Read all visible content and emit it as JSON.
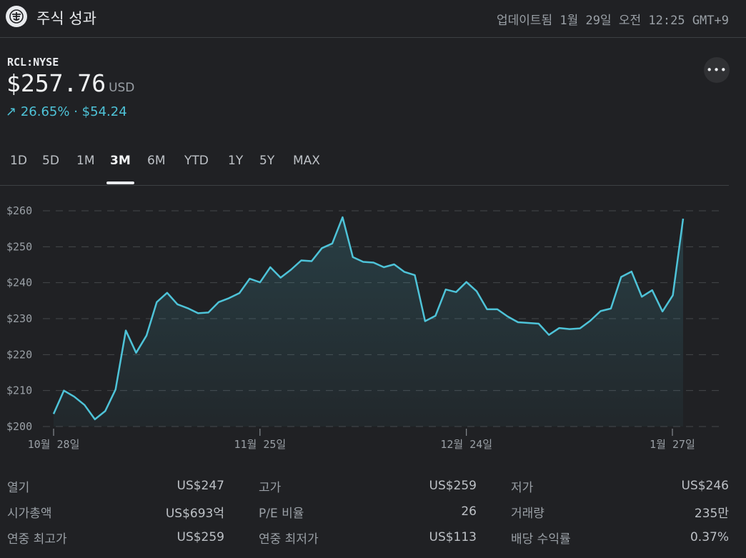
{
  "header": {
    "title": "주식 성과",
    "updated": "업데이트됨 1월 29일 오전 12:25 GMT+9",
    "logo_icon": "ship-wheel-icon"
  },
  "quote": {
    "ticker": "RCL:NYSE",
    "price": "$257.76",
    "currency": "USD",
    "change_arrow": "↗",
    "change_percent": "26.65%",
    "separator": "·",
    "change_amount": "$54.24",
    "more_label": "•••",
    "accent_color": "#4ec3d8"
  },
  "tabs": [
    {
      "label": "1D",
      "active": false
    },
    {
      "label": "5D",
      "active": false
    },
    {
      "label": "1M",
      "active": false
    },
    {
      "label": "3M",
      "active": true
    },
    {
      "label": "6M",
      "active": false
    },
    {
      "label": "YTD",
      "active": false
    },
    {
      "label": "1Y",
      "active": false
    },
    {
      "label": "5Y",
      "active": false
    },
    {
      "label": "MAX",
      "active": false
    }
  ],
  "chart_data": {
    "type": "area",
    "ylim": [
      200,
      260
    ],
    "yticks": [
      260,
      250,
      240,
      230,
      220,
      210,
      200
    ],
    "ytick_labels": [
      "$260",
      "$250",
      "$240",
      "$230",
      "$220",
      "$210",
      "$200"
    ],
    "xtick_labels": [
      "10월 28일",
      "11월 25일",
      "12월 24일",
      "1월 27일"
    ],
    "xtick_index": [
      0,
      20,
      40,
      60
    ],
    "grid": true,
    "line_color": "#4ec3d8",
    "series": [
      {
        "values": [
          203.5,
          210,
          208.3,
          206,
          202,
          204.3,
          210.3,
          226.7,
          220.5,
          225.3,
          234.6,
          237.2,
          234,
          232.9,
          231.5,
          231.7,
          234.6,
          235.7,
          237.1,
          241.1,
          240.1,
          244.3,
          241.4,
          243.6,
          246.2,
          246,
          249.6,
          250.9,
          258.2,
          247.1,
          245.8,
          245.6,
          244.3,
          245.1,
          243,
          242.1,
          229.3,
          230.8,
          238.1,
          237.4,
          240.2,
          237.6,
          232.6,
          232.6,
          230.6,
          229,
          228.8,
          228.6,
          225.5,
          227.4,
          227.1,
          227.3,
          229.4,
          232.1,
          232.8,
          241.6,
          243.1,
          236.1,
          237.9,
          232,
          236.5,
          257.8
        ]
      }
    ]
  },
  "stats": [
    {
      "label": "열기",
      "value": "US$247"
    },
    {
      "label": "고가",
      "value": "US$259"
    },
    {
      "label": "저가",
      "value": "US$246"
    },
    {
      "label": "시가총액",
      "value": "US$693억"
    },
    {
      "label": "P/E 비율",
      "value": "26"
    },
    {
      "label": "거래량",
      "value": "235만"
    },
    {
      "label": "연중 최고가",
      "value": "US$259"
    },
    {
      "label": "연중 최저가",
      "value": "US$113"
    },
    {
      "label": "배당 수익률",
      "value": "0.37%"
    }
  ]
}
